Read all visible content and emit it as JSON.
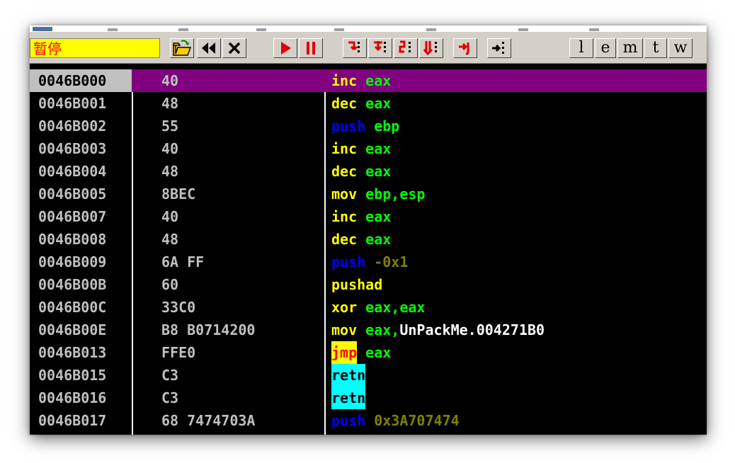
{
  "toolbar": {
    "status_text": "暂停",
    "letters": [
      "l",
      "e",
      "m",
      "t",
      "w"
    ]
  },
  "colors": {
    "selected_row": "#800080",
    "status_bg": "#ffff00",
    "status_fg": "#ff0000",
    "register": "#00ff00",
    "mnemonic": "#ffff00",
    "push": "#0000ff",
    "immediate": "#808000",
    "ret_highlight": "#00ffff"
  },
  "rows": [
    {
      "addr": "0046B000",
      "hex": "40",
      "mn": "inc",
      "op": "eax",
      "mn_style": "normal",
      "op_style": "reg",
      "selected": true
    },
    {
      "addr": "0046B001",
      "hex": "48",
      "mn": "dec",
      "op": "eax",
      "mn_style": "normal",
      "op_style": "reg"
    },
    {
      "addr": "0046B002",
      "hex": "55",
      "mn": "push",
      "op": "ebp",
      "mn_style": "push",
      "op_style": "reg"
    },
    {
      "addr": "0046B003",
      "hex": "40",
      "mn": "inc",
      "op": "eax",
      "mn_style": "normal",
      "op_style": "reg"
    },
    {
      "addr": "0046B004",
      "hex": "48",
      "mn": "dec",
      "op": "eax",
      "mn_style": "normal",
      "op_style": "reg"
    },
    {
      "addr": "0046B005",
      "hex": "8BEC",
      "mn": "mov",
      "op": "ebp,esp",
      "mn_style": "normal",
      "op_style": "reg"
    },
    {
      "addr": "0046B007",
      "hex": "40",
      "mn": "inc",
      "op": "eax",
      "mn_style": "normal",
      "op_style": "reg"
    },
    {
      "addr": "0046B008",
      "hex": "48",
      "mn": "dec",
      "op": "eax",
      "mn_style": "normal",
      "op_style": "reg"
    },
    {
      "addr": "0046B009",
      "hex": "6A FF",
      "mn": "push",
      "op": "-0x1",
      "mn_style": "push",
      "op_style": "imm"
    },
    {
      "addr": "0046B00B",
      "hex": "60",
      "mn": "pushad",
      "op": "",
      "mn_style": "normal",
      "op_style": "reg"
    },
    {
      "addr": "0046B00C",
      "hex": "33C0",
      "mn": "xor",
      "op": "eax,eax",
      "mn_style": "normal",
      "op_style": "reg"
    },
    {
      "addr": "0046B00E",
      "hex": "B8 B0714200",
      "mn": "mov",
      "op": "eax,",
      "op2": "UnPackMe.004271B0",
      "mn_style": "normal",
      "op_style": "reg",
      "op2_style": "sym"
    },
    {
      "addr": "0046B013",
      "hex": "FFE0",
      "mn": "jmp",
      "op": "eax",
      "mn_style": "jmp",
      "op_style": "reg"
    },
    {
      "addr": "0046B015",
      "hex": "C3",
      "mn": "retn",
      "op": "",
      "mn_style": "ret",
      "op_style": "reg"
    },
    {
      "addr": "0046B016",
      "hex": "C3",
      "mn": "retn",
      "op": "",
      "mn_style": "ret",
      "op_style": "reg"
    },
    {
      "addr": "0046B017",
      "hex": "68 7474703A",
      "mn": "push",
      "op": "0x3A707474",
      "mn_style": "push",
      "op_style": "imm"
    }
  ]
}
